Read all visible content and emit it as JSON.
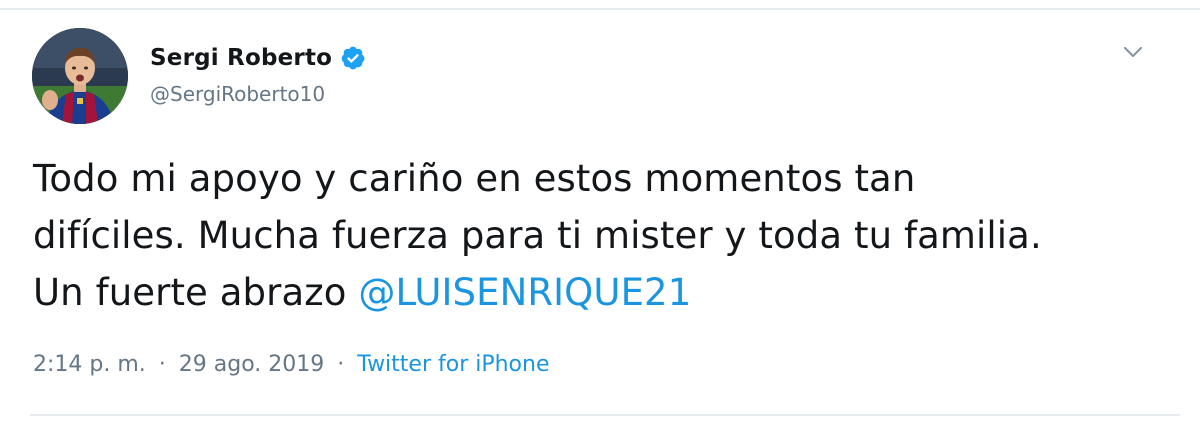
{
  "tweet": {
    "author": {
      "name": "Sergi Roberto",
      "handle": "@SergiRoberto10",
      "verified": true
    },
    "text_lines": [
      "Todo mi apoyo y cariño en estos momentos tan",
      "difíciles. Mucha fuerza para ti mister y toda tu familia.",
      "Un fuerte abrazo "
    ],
    "mention": "@LUISENRIQUE21",
    "time": "2:14 p. m.",
    "date": "29 ago. 2019",
    "separator": "·",
    "source": "Twitter for iPhone"
  },
  "icons": {
    "verified": "verified-badge-icon",
    "caret": "chevron-down-icon"
  },
  "colors": {
    "text": "#14171a",
    "secondary": "#657786",
    "link": "#1b95e0",
    "verified": "#1da1f2",
    "border": "#e6ecf0"
  }
}
